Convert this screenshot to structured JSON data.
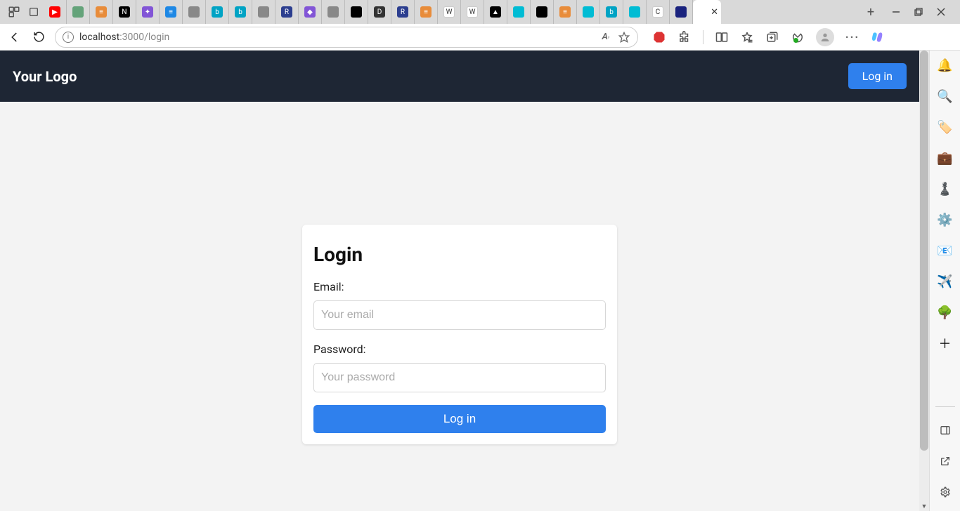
{
  "browser": {
    "url_host": "localhost",
    "url_path": ":3000/login",
    "tabs": [
      {
        "icon": "▶",
        "cls": "fv-red"
      },
      {
        "icon": "",
        "cls": "fv-green"
      },
      {
        "icon": "≡",
        "cls": "fv-orange"
      },
      {
        "icon": "N",
        "cls": "fv-black"
      },
      {
        "icon": "✦",
        "cls": "fv-purple"
      },
      {
        "icon": "≡",
        "cls": "fv-blue"
      },
      {
        "icon": "",
        "cls": "fv-gray"
      },
      {
        "icon": "b",
        "cls": "fv-teal"
      },
      {
        "icon": "b",
        "cls": "fv-teal"
      },
      {
        "icon": "",
        "cls": "fv-gray"
      },
      {
        "icon": "R",
        "cls": "fv-darkblue"
      },
      {
        "icon": "◆",
        "cls": "fv-purple"
      },
      {
        "icon": "",
        "cls": "fv-gray"
      },
      {
        "icon": "",
        "cls": "fv-black"
      },
      {
        "icon": "D",
        "cls": "fv-dkgray"
      },
      {
        "icon": "R",
        "cls": "fv-darkblue"
      },
      {
        "icon": "≡",
        "cls": "fv-orange"
      },
      {
        "icon": "W",
        "cls": "fv-white"
      },
      {
        "icon": "W",
        "cls": "fv-white"
      },
      {
        "icon": "▲",
        "cls": "fv-black"
      },
      {
        "icon": "",
        "cls": "fv-cyan"
      },
      {
        "icon": "",
        "cls": "fv-black"
      },
      {
        "icon": "≡",
        "cls": "fv-orange"
      },
      {
        "icon": "",
        "cls": "fv-cyan"
      },
      {
        "icon": "b",
        "cls": "fv-teal"
      },
      {
        "icon": "",
        "cls": "fv-cyan"
      },
      {
        "icon": "C",
        "cls": "fv-white"
      },
      {
        "icon": "",
        "cls": "fv-navy"
      }
    ]
  },
  "app": {
    "brand": "Your Logo",
    "header_login": "Log in",
    "card": {
      "title": "Login",
      "email_label": "Email:",
      "email_placeholder": "Your email",
      "password_label": "Password:",
      "password_placeholder": "Your password",
      "submit": "Log in"
    }
  }
}
